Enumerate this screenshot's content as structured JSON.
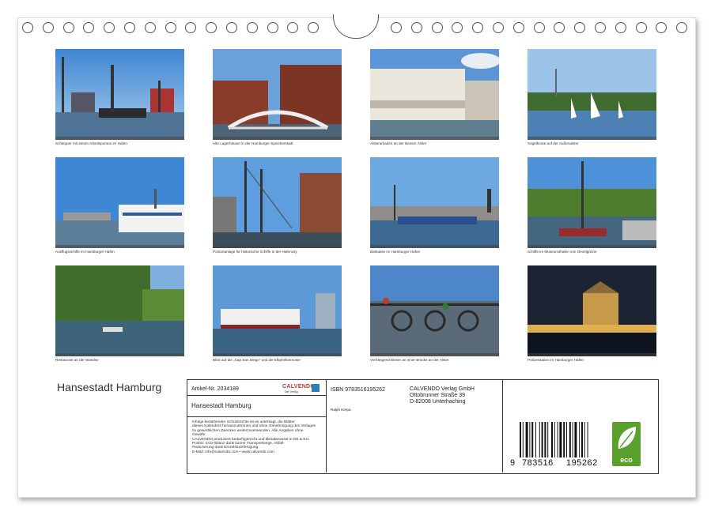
{
  "calendar_title": "Hansestadt Hamburg",
  "photos": [
    {
      "caption": "Schlepper mit einem Arbeitsponton im Hafen"
    },
    {
      "caption": "Alte Lagerhäuser in der Hamburger Speicherstadt"
    },
    {
      "caption": "Alsterarkaden an der kleinen Alster"
    },
    {
      "caption": "Segelboote auf der Außenalster"
    },
    {
      "caption": "Ausflugsschiffe im Hamburger Hafen"
    },
    {
      "caption": "Pontonanlage für historische Schiffe in der Hafencity"
    },
    {
      "caption": "Barkasse im Hamburger Hafen"
    },
    {
      "caption": "Schiffe im Museumshafen von Oevelgönne"
    },
    {
      "caption": "Restaurant an der Wandse"
    },
    {
      "caption": "Blick auf die „Cap San Diego“ und die Elbphilharmonie"
    },
    {
      "caption": "Vorhängeschlösser an einer Brücke an der Alster"
    },
    {
      "caption": "Polizeistation im Hamburger Hafen"
    }
  ],
  "info": {
    "article_no": "Artikel-Nr. 2034189",
    "brand": "CALVENDO",
    "brand_tag": "Der Verlag",
    "title": "Hansestadt Hamburg",
    "isbn": "ISBN 9783516195262",
    "author": "Ralph Kerpa",
    "publisher_lines": [
      "CALVENDO Verlag GmbH",
      "Ottobrunner Straße 39",
      "D-82008 Unterhaching"
    ],
    "legal_lines": [
      "Infolge bestehender Schutzrechte ist es untersagt, die Blätter",
      "dieses Kalenders herauszutrennen und ohne Genehmigung des Verlages",
      "zu gewerblichen Zwecken weiterzuverwenden. Alle Angaben ohne",
      "Gewähr.",
      "CALVENDO produziert bedarfsgerecht und klimabewusst in DE & EU.",
      "Positiv: CO2-Bilanz dank kurzer Transportwege, Abfall-",
      "Reduzierung dank Einzelstückfertigung.",
      "E-Mail: info@calvendo.com • www.calvendo.com"
    ],
    "barcode_first": "9",
    "barcode_left": "783516",
    "barcode_right": "195262",
    "eco_label": "eco"
  },
  "colors": {
    "eco_green": "#5aa02c",
    "brand_red": "#c0392b"
  }
}
